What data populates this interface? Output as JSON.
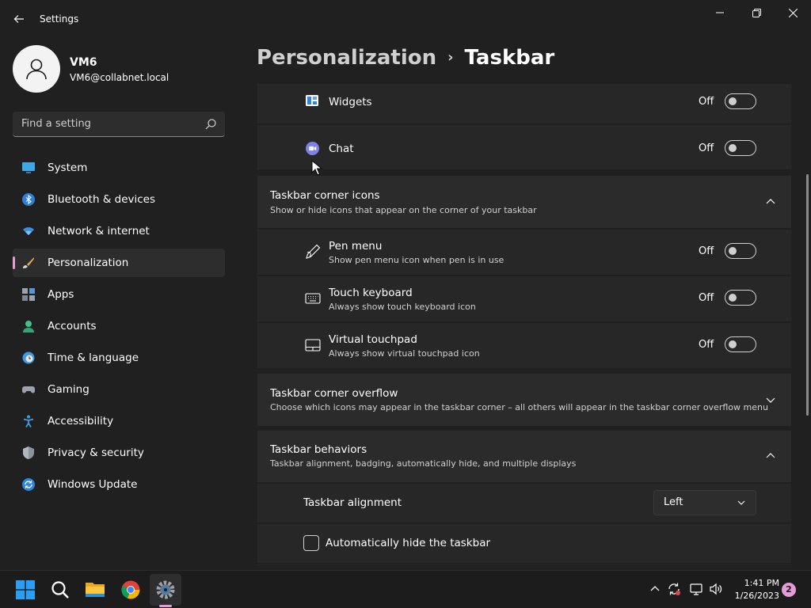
{
  "app": {
    "title": "Settings"
  },
  "profile": {
    "name": "VM6",
    "email": "VM6@collabnet.local"
  },
  "search": {
    "placeholder": "Find a setting"
  },
  "nav": {
    "items": [
      {
        "label": "System",
        "icon": "monitor-icon"
      },
      {
        "label": "Bluetooth & devices",
        "icon": "bluetooth-icon"
      },
      {
        "label": "Network & internet",
        "icon": "wifi-icon"
      },
      {
        "label": "Personalization",
        "icon": "brush-icon",
        "active": true
      },
      {
        "label": "Apps",
        "icon": "apps-icon"
      },
      {
        "label": "Accounts",
        "icon": "person-icon"
      },
      {
        "label": "Time & language",
        "icon": "clock-globe-icon"
      },
      {
        "label": "Gaming",
        "icon": "gamepad-icon"
      },
      {
        "label": "Accessibility",
        "icon": "accessibility-icon"
      },
      {
        "label": "Privacy & security",
        "icon": "shield-icon"
      },
      {
        "label": "Windows Update",
        "icon": "update-icon"
      }
    ]
  },
  "breadcrumb": {
    "parent": "Personalization",
    "separator": "›",
    "current": "Taskbar"
  },
  "items": {
    "widgets": {
      "title": "Widgets",
      "state": "Off"
    },
    "chat": {
      "title": "Chat",
      "state": "Off"
    }
  },
  "corner_icons": {
    "title": "Taskbar corner icons",
    "desc": "Show or hide icons that appear on the corner of your taskbar",
    "expanded": true,
    "pen": {
      "title": "Pen menu",
      "desc": "Show pen menu icon when pen is in use",
      "state": "Off"
    },
    "keyboard": {
      "title": "Touch keyboard",
      "desc": "Always show touch keyboard icon",
      "state": "Off"
    },
    "touchpad": {
      "title": "Virtual touchpad",
      "desc": "Always show virtual touchpad icon",
      "state": "Off"
    }
  },
  "overflow": {
    "title": "Taskbar corner overflow",
    "desc": "Choose which icons may appear in the taskbar corner – all others will appear in the taskbar corner overflow menu",
    "expanded": false
  },
  "behaviors": {
    "title": "Taskbar behaviors",
    "desc": "Taskbar alignment, badging, automatically hide, and multiple displays",
    "expanded": true,
    "alignment": {
      "label": "Taskbar alignment",
      "value": "Left"
    },
    "autohide": {
      "label": "Automatically hide the taskbar",
      "checked": false
    }
  },
  "taskbar": {
    "apps": [
      "start-icon",
      "search-icon",
      "file-explorer-icon",
      "chrome-icon",
      "settings-icon"
    ],
    "clock": {
      "time": "1:41 PM",
      "date": "1/26/2023"
    },
    "notification_count": "2"
  },
  "colors": {
    "accent": "#e59bd8",
    "background": "#202020",
    "card": "#2b2b2b"
  }
}
